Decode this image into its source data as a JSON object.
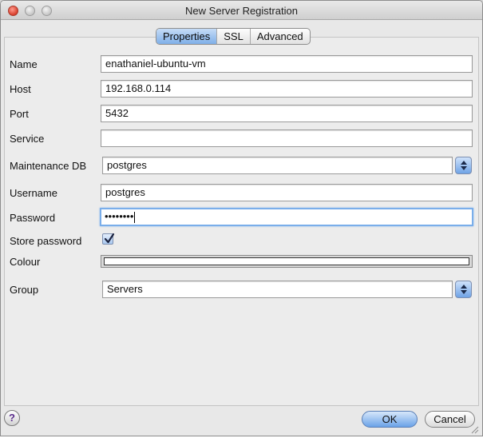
{
  "window": {
    "title": "New Server Registration"
  },
  "tabs": [
    "Properties",
    "SSL",
    "Advanced"
  ],
  "form": {
    "name": {
      "label": "Name",
      "value": "enathaniel-ubuntu-vm"
    },
    "host": {
      "label": "Host",
      "value": "192.168.0.114"
    },
    "port": {
      "label": "Port",
      "value": "5432"
    },
    "service": {
      "label": "Service",
      "value": ""
    },
    "maintenance_db": {
      "label": "Maintenance DB",
      "value": "postgres"
    },
    "username": {
      "label": "Username",
      "value": "postgres"
    },
    "password": {
      "label": "Password",
      "value": "••••••••"
    },
    "store_password": {
      "label": "Store password",
      "checked": true
    },
    "colour": {
      "label": "Colour",
      "value_color": "#ffffff"
    },
    "group": {
      "label": "Group",
      "value": "Servers"
    }
  },
  "buttons": {
    "help": "?",
    "ok": "OK",
    "cancel": "Cancel"
  },
  "icons": {
    "close": "close-icon",
    "minimize": "minimize-icon",
    "zoom": "zoom-icon",
    "checkmark": "checkmark-icon",
    "stepper": "stepper-arrows-icon",
    "resize": "resize-grip-icon"
  },
  "colors": {
    "accent": "#7fafe8",
    "focus_ring": "#7aaeea"
  }
}
